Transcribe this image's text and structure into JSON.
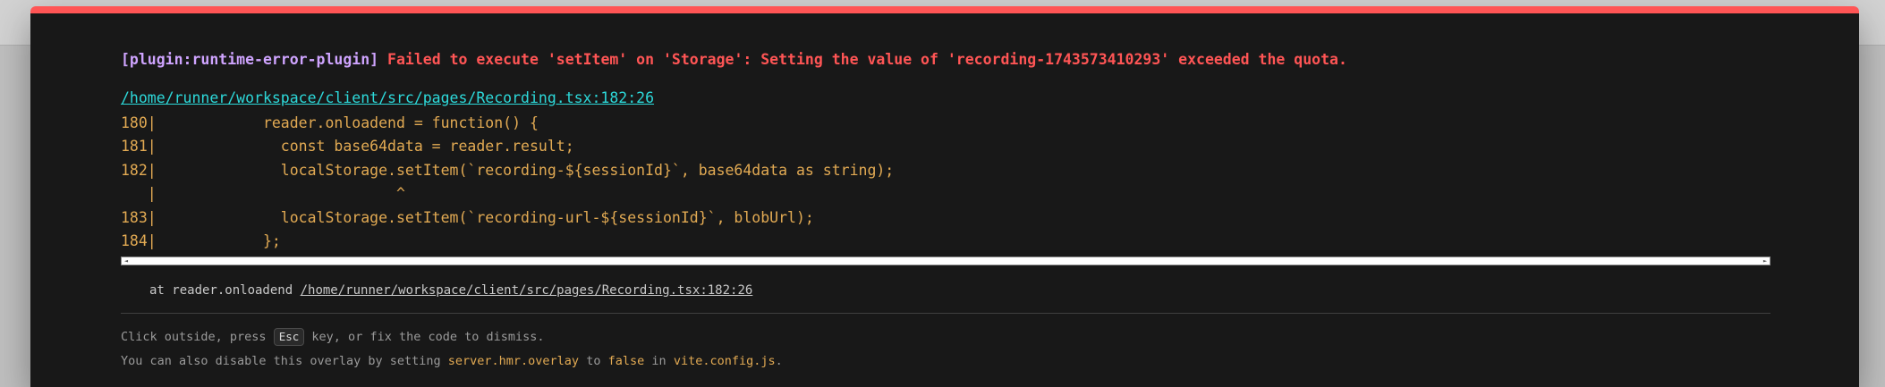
{
  "error": {
    "plugin": "[plugin:runtime-error-plugin]",
    "message": "Failed to execute 'setItem' on 'Storage': Setting the value of 'recording-1743573410293' exceeded the quota.",
    "file": "/home/runner/workspace/client/src/pages/Recording.tsx:182:26"
  },
  "frame": {
    "lines": [
      "180|            reader.onloadend = function() {",
      "181|              const base64data = reader.result;",
      "182|              localStorage.setItem(`recording-${sessionId}`, base64data as string);",
      "   |                           ^",
      "183|              localStorage.setItem(`recording-url-${sessionId}`, blobUrl);",
      "184|            };"
    ]
  },
  "stack": {
    "prefix": "at reader.onloadend",
    "location": "/home/runner/workspace/client/src/pages/Recording.tsx:182:26"
  },
  "tip": {
    "line1_pre": "Click outside, press",
    "line1_key": "Esc",
    "line1_post": "key, or fix the code to dismiss.",
    "line2_pre": "You can also disable this overlay by setting",
    "line2_code1": "server.hmr.overlay",
    "line2_mid": "to",
    "line2_code2": "false",
    "line2_mid2": "in",
    "line2_code3": "vite.config.js",
    "line2_post": "."
  },
  "scrollbar": {
    "left_arrow": "◄",
    "right_arrow": "►"
  },
  "colors": {
    "accent_red": "#ff5555",
    "plugin_purple": "#cfa4ff",
    "link_cyan": "#2dd9da",
    "code_yellow": "#e2aa53",
    "background": "#181818"
  }
}
